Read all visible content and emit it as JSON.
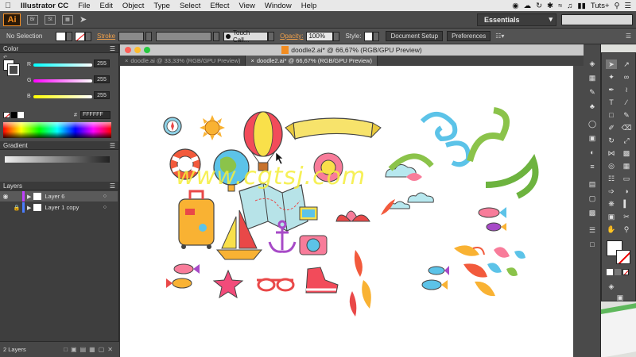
{
  "menubar": {
    "app_name": "Illustrator CC",
    "menus": [
      "File",
      "Edit",
      "Object",
      "Type",
      "Select",
      "Effect",
      "View",
      "Window",
      "Help"
    ],
    "right_user": "Tuts+"
  },
  "appbar": {
    "logo": "Ai",
    "bridge": "Br",
    "stock": "St",
    "workspace": "Essentials"
  },
  "control": {
    "selection": "No Selection",
    "stroke_label": "Stroke",
    "brush": "Touch Call...",
    "opacity_label": "Opacity:",
    "opacity_value": "100%",
    "style_label": "Style:",
    "doc_setup": "Document Setup",
    "preferences": "Preferences"
  },
  "color_panel": {
    "title": "Color",
    "channels": [
      {
        "name": "R",
        "value": "255"
      },
      {
        "name": "G",
        "value": "255"
      },
      {
        "name": "B",
        "value": "255"
      }
    ],
    "hex_symbol": "#",
    "hex": "FFFFFF"
  },
  "gradient_panel": {
    "title": "Gradient"
  },
  "layers_panel": {
    "title": "Layers",
    "layers": [
      {
        "name": "Layer 6",
        "color": "#c040ff"
      },
      {
        "name": "Layer 1 copy",
        "color": "#4a7cff"
      }
    ],
    "count": "2 Layers"
  },
  "document": {
    "title": "doodle2.ai* @ 66,67% (RGB/GPU Preview)",
    "tabs": [
      {
        "label": "doodle.ai @ 33,33% (RGB/GPU Preview)"
      },
      {
        "label": "doodle2.ai* @ 66,67% (RGB/GPU Preview)"
      }
    ]
  },
  "watermark": "www.cgtsj.com",
  "colors": {
    "accent": "#f38d21",
    "panel": "#4b4b4b",
    "canvas": "#ffffff"
  }
}
